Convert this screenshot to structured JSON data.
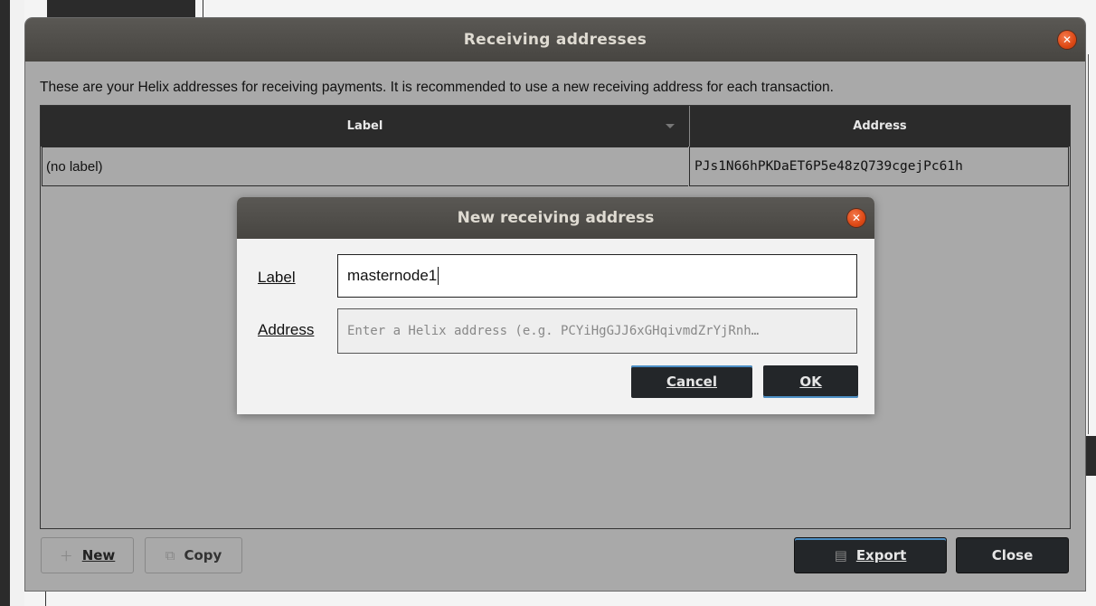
{
  "main_dialog": {
    "title": "Receiving addresses",
    "description": "These are your Helix addresses for receiving payments. It is recommended to use a new receiving address for each transaction.",
    "table": {
      "columns": [
        "Label",
        "Address"
      ],
      "rows": [
        {
          "label": "(no label)",
          "address": "PJs1N66hPKDaET6P5e48zQ739cgejPc61h"
        }
      ]
    },
    "buttons": {
      "new": "New",
      "copy": "Copy",
      "export": "Export",
      "close": "Close"
    }
  },
  "sub_dialog": {
    "title": "New receiving address",
    "label_field_label": "Label",
    "label_value": "masternode1",
    "address_field_label": "Address",
    "address_placeholder": "Enter a Helix address (e.g. PCYiHgGJJ6xGHqivmdZrYjRnh…",
    "buttons": {
      "cancel": "Cancel",
      "ok": "OK"
    }
  },
  "colors": {
    "titlebar": "#4f4d49",
    "close_button": "#dd4814",
    "dark_button": "#232629",
    "table_header": "#2b2b2b",
    "dialog_body": "#a9a9a9"
  }
}
